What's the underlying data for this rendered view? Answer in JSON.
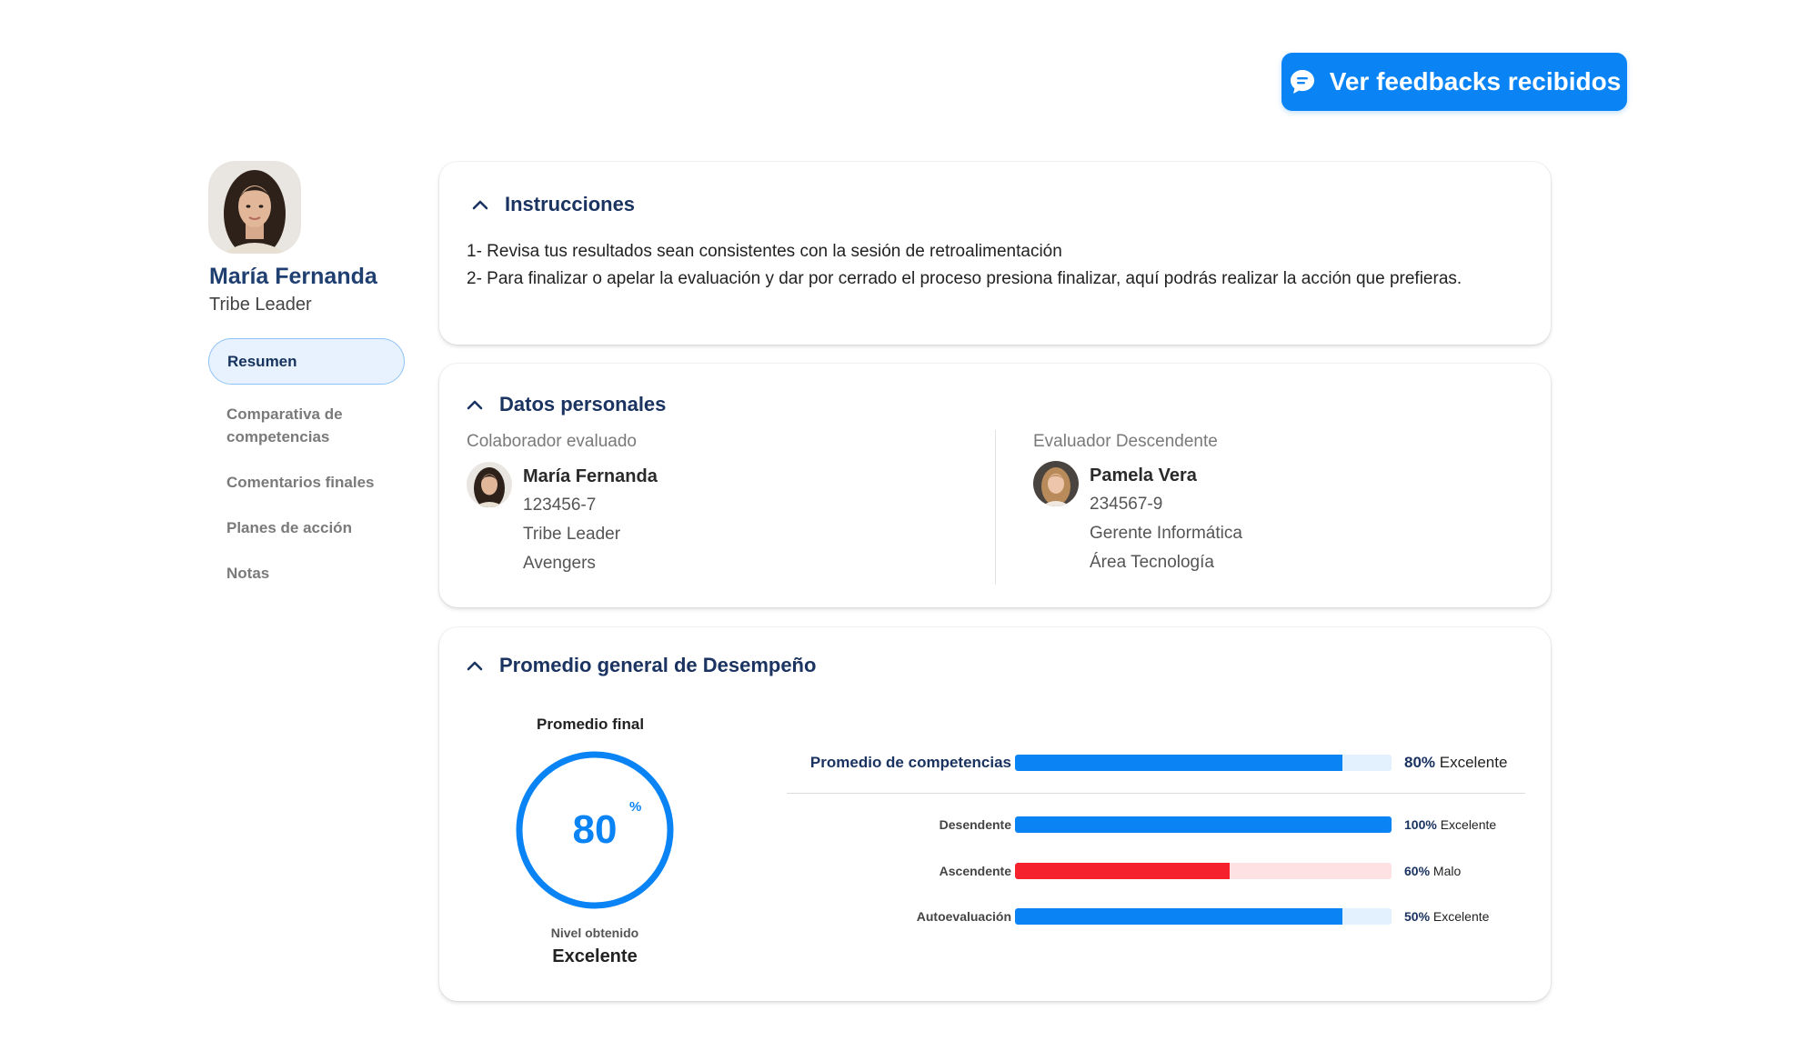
{
  "header": {
    "feedback_button": "Ver feedbacks recibidos"
  },
  "profile": {
    "name": "María Fernanda",
    "role": "Tribe Leader"
  },
  "nav": {
    "items": [
      {
        "label": "Resumen",
        "active": true
      },
      {
        "label": "Comparativa de competencias",
        "active": false
      },
      {
        "label": "Comentarios finales",
        "active": false
      },
      {
        "label": "Planes de acción",
        "active": false
      },
      {
        "label": "Notas",
        "active": false
      }
    ]
  },
  "instructions": {
    "title": "Instrucciones",
    "line1": "1- Revisa tus resultados sean consistentes con la sesión de retroalimentación",
    "line2": "2- Para finalizar o apelar la evaluación y dar por cerrado el proceso presiona finalizar, aquí podrás realizar la acción que prefieras."
  },
  "personal": {
    "title": "Datos personales",
    "evaluated": {
      "label": "Colaborador evaluado",
      "name": "María Fernanda",
      "id": "123456-7",
      "role": "Tribe Leader",
      "team": "Avengers"
    },
    "evaluator": {
      "label": "Evaluador Descendente",
      "name": "Pamela Vera",
      "id": "234567-9",
      "role": "Gerente Informática",
      "area": "Área Tecnología"
    }
  },
  "performance": {
    "title": "Promedio general de Desempeño",
    "final_label": "Promedio final",
    "final_value": "80",
    "final_unit": "%",
    "final_fraction": 0.8,
    "level_label": "Nivel obtenido",
    "level_value": "Excelente",
    "bars": [
      {
        "label": "Promedio de competencias",
        "fraction": 0.87,
        "pct": "80%",
        "rating": "Excelente",
        "kind": "main"
      },
      {
        "label": "Desendente",
        "fraction": 1.0,
        "pct": "100%",
        "rating": "Excelente",
        "kind": "sub"
      },
      {
        "label": "Ascendente",
        "fraction": 0.57,
        "pct": "60%",
        "rating": "Malo",
        "kind": "sub"
      },
      {
        "label": "Autoevaluación",
        "fraction": 0.87,
        "pct": "50%",
        "rating": "Excelente",
        "kind": "sub"
      }
    ]
  },
  "colors": {
    "accent": "#0a84f5",
    "accent_track": "#e3f0fd",
    "bad": "#f5222d",
    "bad_track": "#fde1e3",
    "heading": "#1a3360"
  }
}
